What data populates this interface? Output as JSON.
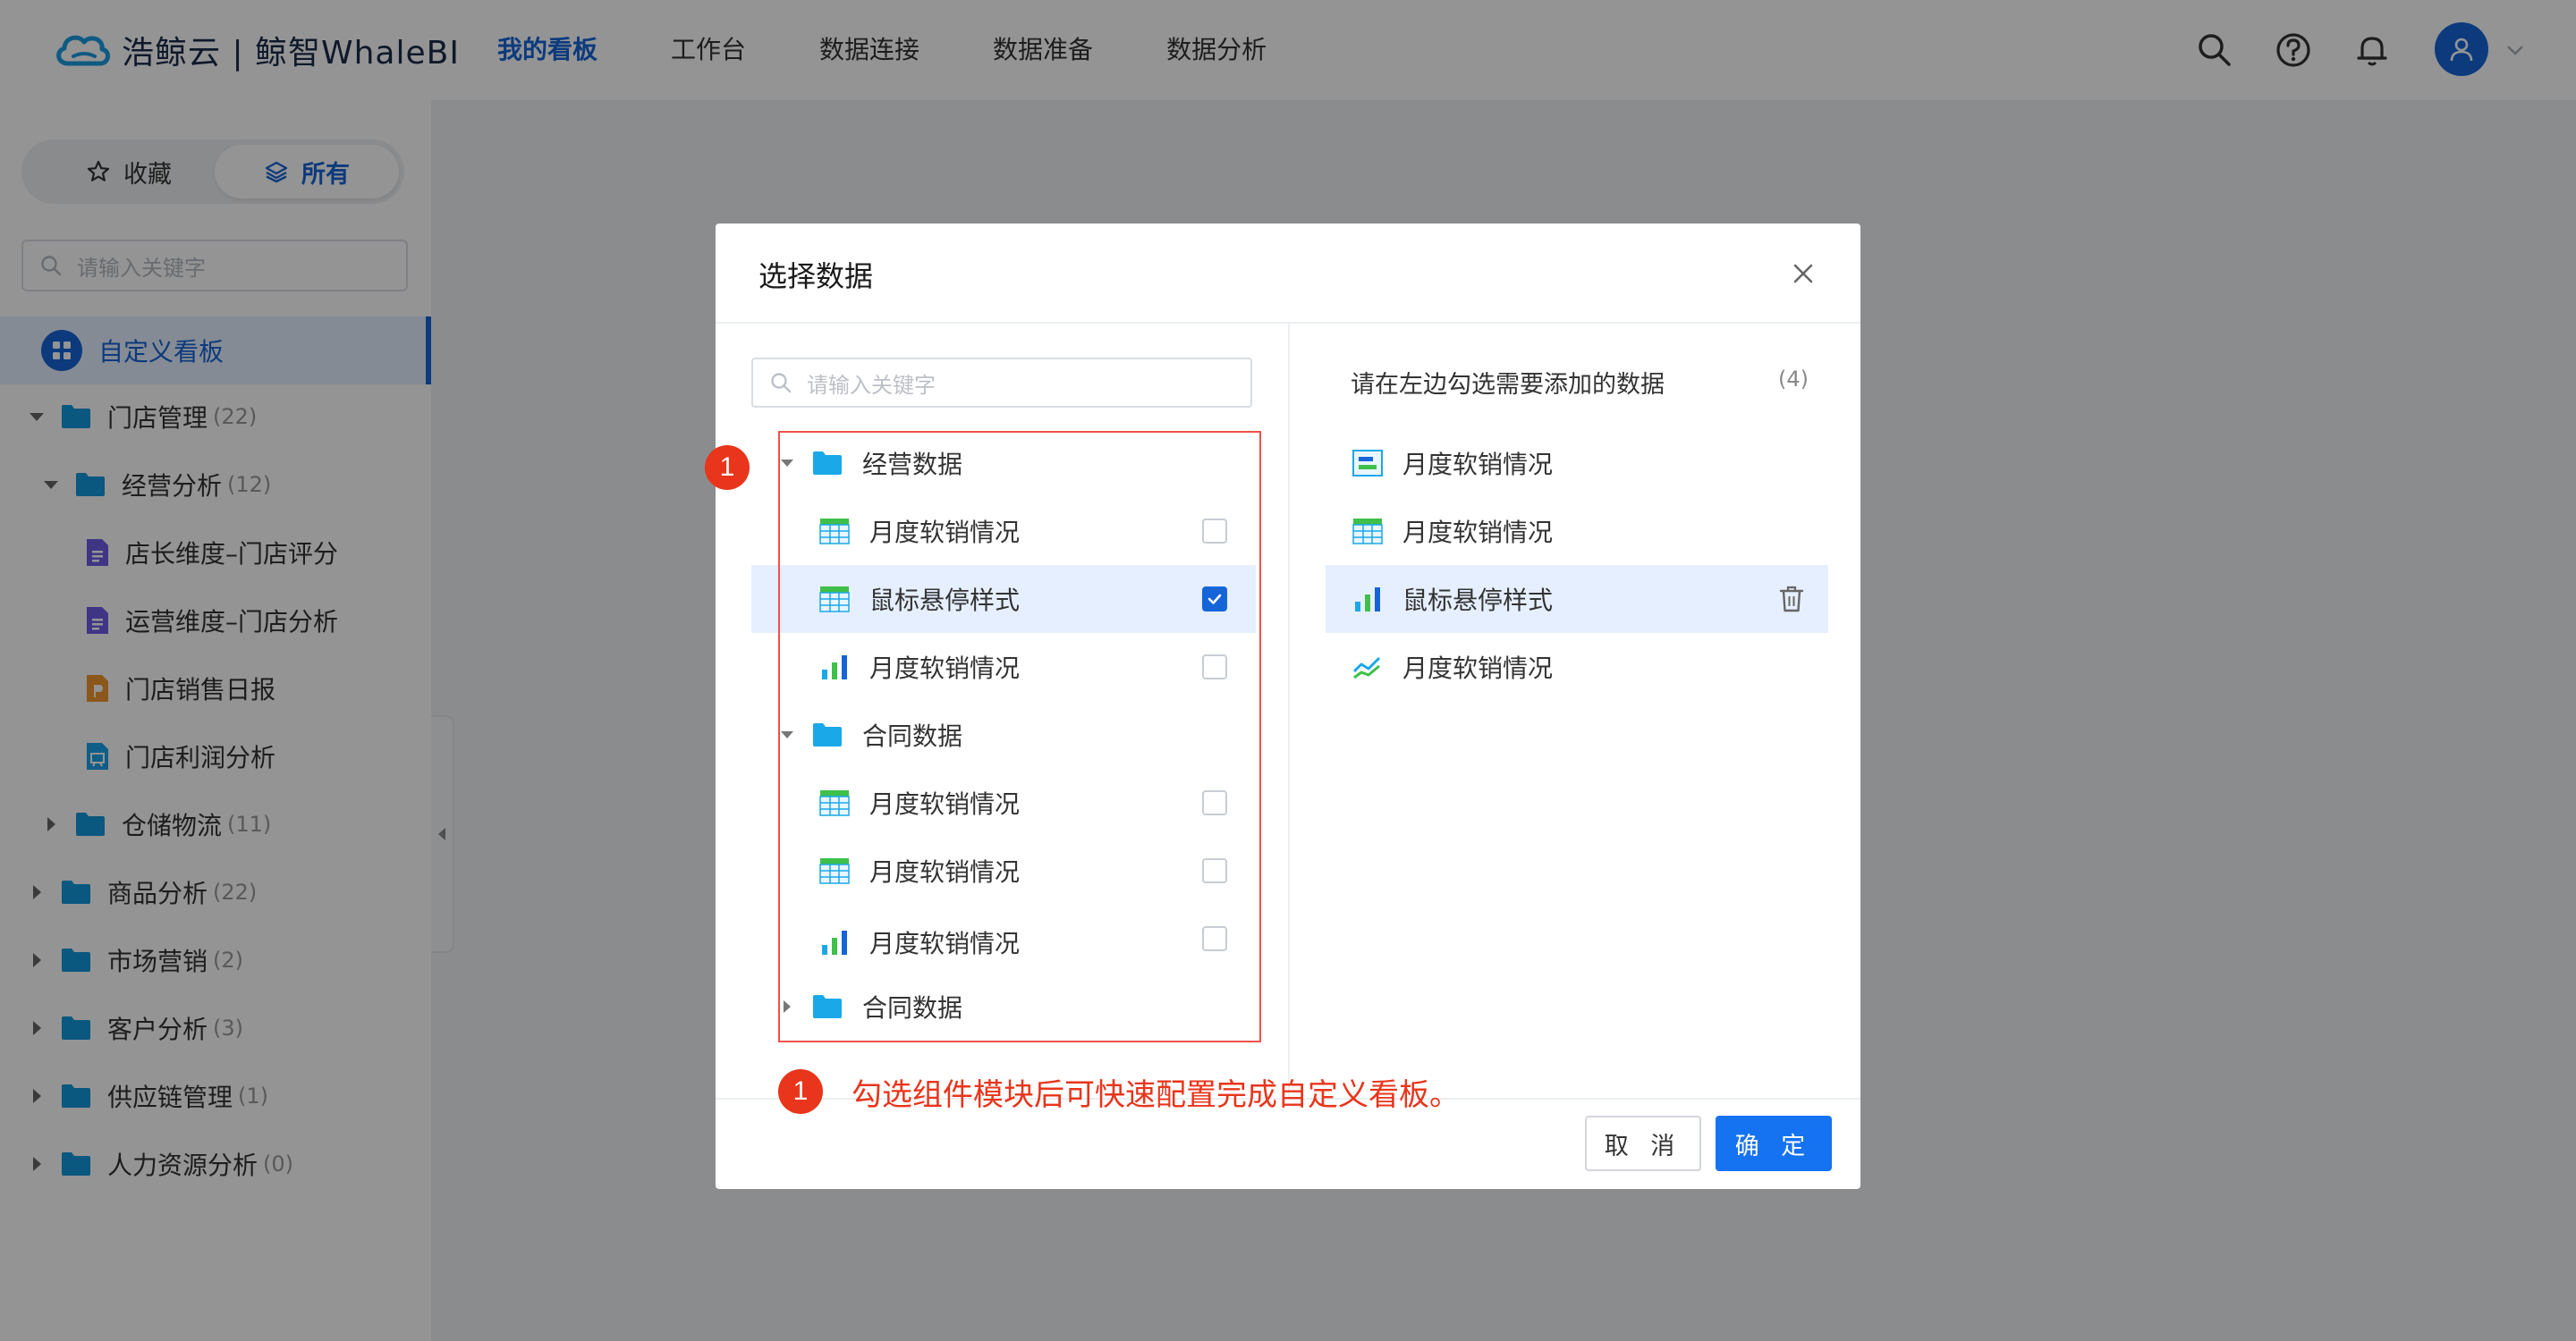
{
  "header": {
    "logo_text": "浩鲸云 | 鲸智WhaleBI",
    "nav": [
      {
        "label": "我的看板",
        "active": true
      },
      {
        "label": "工作台",
        "active": false
      },
      {
        "label": "数据连接",
        "active": false
      },
      {
        "label": "数据准备",
        "active": false
      },
      {
        "label": "数据分析",
        "active": false
      }
    ],
    "icons": [
      "search-icon",
      "help-icon",
      "bell-icon",
      "user-icon",
      "chevron-down-icon"
    ]
  },
  "sidebar": {
    "tabs": {
      "favorites": "收藏",
      "all": "所有"
    },
    "search_placeholder": "请输入关键字",
    "active_item": "自定义看板",
    "tree": [
      {
        "label": "门店管理",
        "count": "(22)"
      },
      {
        "label": "经营分析",
        "count": "(12)"
      },
      {
        "label": "店长维度–门店评分"
      },
      {
        "label": "运营维度–门店分析"
      },
      {
        "label": "门店销售日报"
      },
      {
        "label": "门店利润分析"
      },
      {
        "label": "仓储物流",
        "count": "(11)"
      },
      {
        "label": "商品分析",
        "count": "(22)"
      },
      {
        "label": "市场营销",
        "count": "(2)"
      },
      {
        "label": "客户分析",
        "count": "(3)"
      },
      {
        "label": "供应链管理",
        "count": "(1)"
      },
      {
        "label": "人力资源分析",
        "count": "(0)"
      }
    ]
  },
  "dialog": {
    "title": "选择数据",
    "search_placeholder": "请输入关键字",
    "left_tree": [
      {
        "type": "folder",
        "label": "经营数据"
      },
      {
        "type": "table",
        "label": "月度软销情况",
        "checked": false
      },
      {
        "type": "table",
        "label": "鼠标悬停样式",
        "checked": true
      },
      {
        "type": "bar",
        "label": "月度软销情况",
        "checked": false
      },
      {
        "type": "folder",
        "label": "合同数据"
      },
      {
        "type": "table",
        "label": "月度软销情况",
        "checked": false
      },
      {
        "type": "table",
        "label": "月度软销情况",
        "checked": false
      },
      {
        "type": "bar",
        "label": "月度软销情况",
        "checked": false
      },
      {
        "type": "folder",
        "label": "合同数据"
      }
    ],
    "right_header": "请在左边勾选需要添加的数据",
    "right_count": "(4)",
    "right_list": [
      {
        "type": "card",
        "label": "月度软销情况"
      },
      {
        "type": "table",
        "label": "月度软销情况"
      },
      {
        "type": "bar",
        "label": "鼠标悬停样式"
      },
      {
        "type": "line",
        "label": "月度软销情况"
      }
    ],
    "badge_number": "1",
    "hint": "勾选组件模块后可快速配置完成自定义看板。",
    "cancel_label": "取 消",
    "ok_label": "确 定"
  }
}
